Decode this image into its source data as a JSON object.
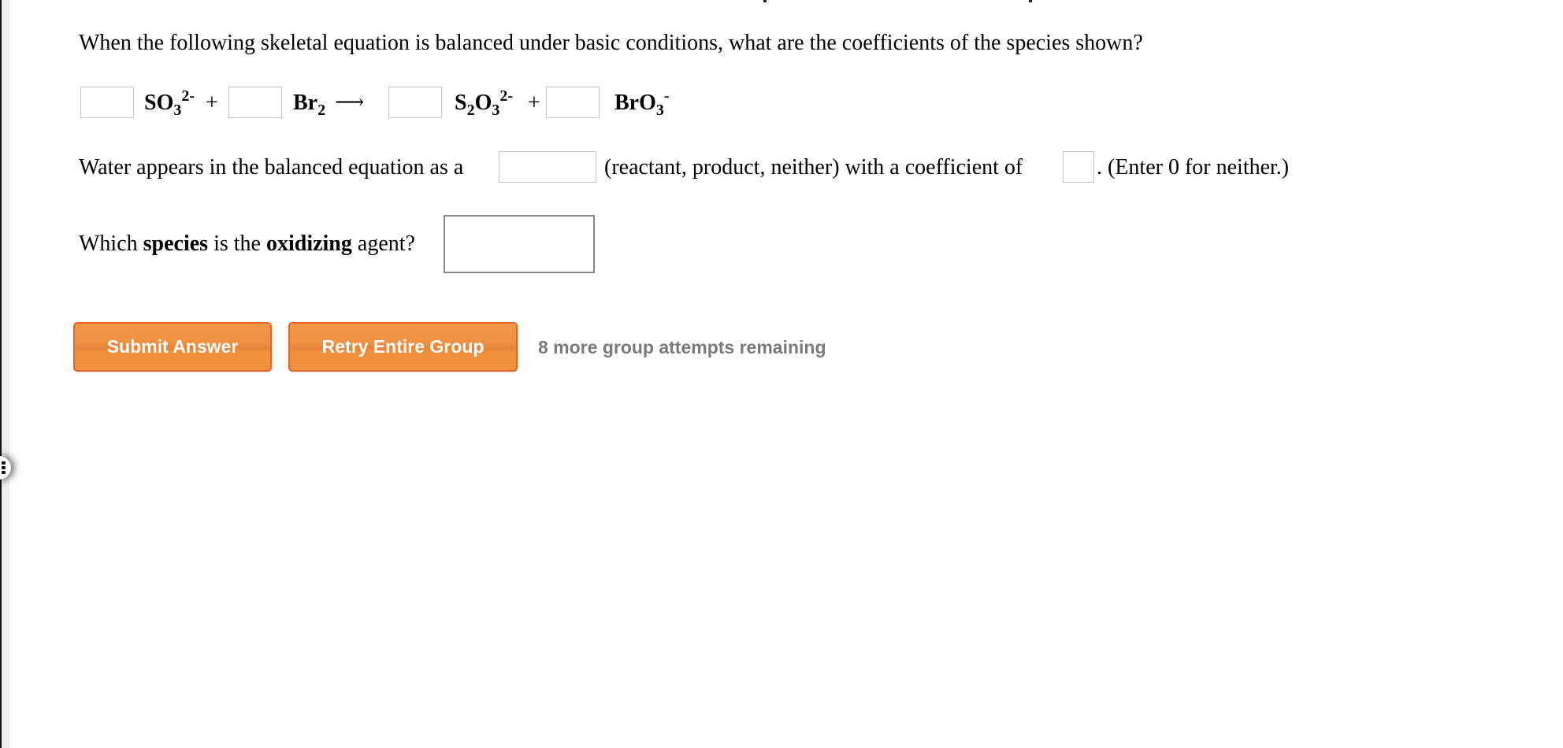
{
  "question": {
    "prompt": "When the following skeletal equation is balanced under basic conditions, what are the coefficients of the species shown?",
    "equation": {
      "species": [
        {
          "base": "SO",
          "sub": "3",
          "charge": "2-"
        },
        {
          "base": "Br",
          "sub": "2",
          "charge": ""
        },
        {
          "base": "S",
          "sub1": "2",
          "mid": "O",
          "sub": "3",
          "charge": "2-"
        },
        {
          "base": "BrO",
          "sub": "3",
          "charge": "-"
        }
      ],
      "plus": "+",
      "arrow": "⟶",
      "coefficients": [
        "",
        "",
        "",
        ""
      ]
    },
    "water": {
      "prefix": "Water appears in the balanced equation as a",
      "role_value": "",
      "middle": "(reactant, product, neither) with a coefficient of",
      "coefficient_value": "",
      "suffix": ". (Enter 0 for neither.)"
    },
    "oxidizing": {
      "part1": "Which",
      "bold1": "species",
      "part2": "is the",
      "bold2": "oxidizing",
      "part3": "agent?",
      "value": ""
    }
  },
  "actions": {
    "submit_label": "Submit Answer",
    "retry_label": "Retry Entire Group",
    "attempts_status": "8 more group attempts remaining"
  },
  "colors": {
    "button_orange": "#f0913f",
    "button_border": "#e0682a",
    "status_grey": "#7a7a7a"
  },
  "icons": {
    "side_handle": "drag-handle-icon"
  }
}
